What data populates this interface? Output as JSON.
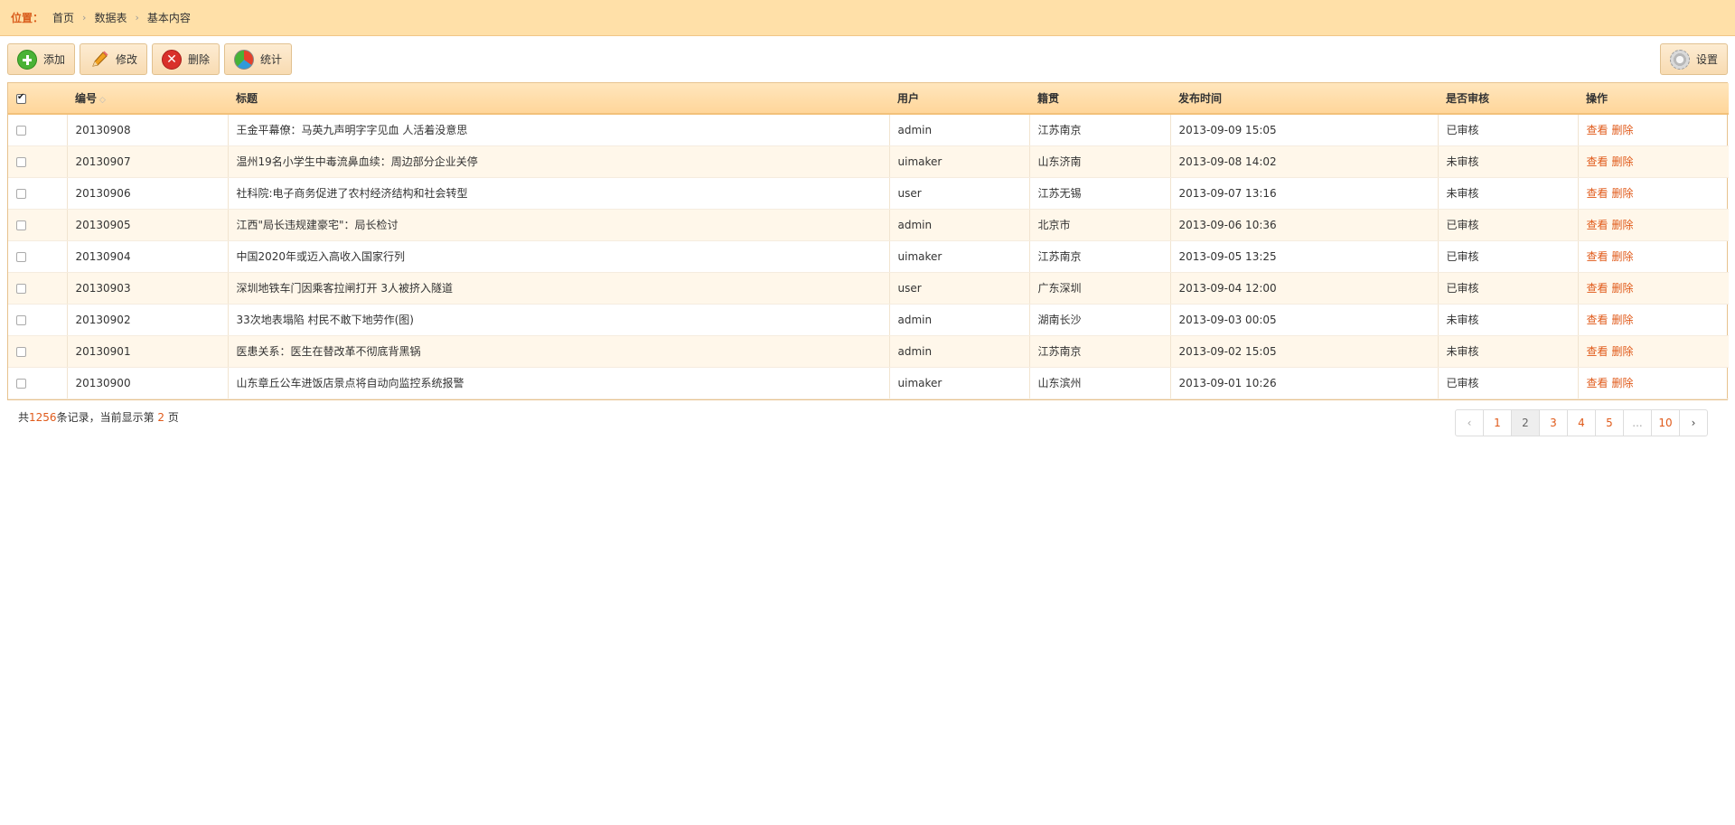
{
  "breadcrumb": {
    "label": "位置：",
    "items": [
      "首页",
      "数据表",
      "基本内容"
    ]
  },
  "toolbar": {
    "add_label": "添加",
    "edit_label": "修改",
    "delete_label": "删除",
    "stats_label": "统计",
    "settings_label": "设置"
  },
  "table": {
    "headers": [
      "编号",
      "标题",
      "用户",
      "籍贯",
      "发布时间",
      "是否审核",
      "操作"
    ],
    "actions": [
      "查看",
      "删除"
    ],
    "rows": [
      {
        "id": "20130908",
        "title": "王金平幕僚：马英九声明字字见血 人活着没意思",
        "user": "admin",
        "origin": "江苏南京",
        "time": "2013-09-09 15:05",
        "status": "已审核"
      },
      {
        "id": "20130907",
        "title": "温州19名小学生中毒流鼻血续：周边部分企业关停",
        "user": "uimaker",
        "origin": "山东济南",
        "time": "2013-09-08 14:02",
        "status": "未审核"
      },
      {
        "id": "20130906",
        "title": "社科院:电子商务促进了农村经济结构和社会转型",
        "user": "user",
        "origin": "江苏无锡",
        "time": "2013-09-07 13:16",
        "status": "未审核"
      },
      {
        "id": "20130905",
        "title": "江西\"局长违规建豪宅\"：局长检讨",
        "user": "admin",
        "origin": "北京市",
        "time": "2013-09-06 10:36",
        "status": "已审核"
      },
      {
        "id": "20130904",
        "title": "中国2020年或迈入高收入国家行列",
        "user": "uimaker",
        "origin": "江苏南京",
        "time": "2013-09-05 13:25",
        "status": "已审核"
      },
      {
        "id": "20130903",
        "title": "深圳地铁车门因乘客拉闸打开 3人被挤入隧道",
        "user": "user",
        "origin": "广东深圳",
        "time": "2013-09-04 12:00",
        "status": "已审核"
      },
      {
        "id": "20130902",
        "title": "33次地表塌陷 村民不敢下地劳作(图)",
        "user": "admin",
        "origin": "湖南长沙",
        "time": "2013-09-03 00:05",
        "status": "未审核"
      },
      {
        "id": "20130901",
        "title": "医患关系：医生在替改革不彻底背黑锅",
        "user": "admin",
        "origin": "江苏南京",
        "time": "2013-09-02 15:05",
        "status": "未审核"
      },
      {
        "id": "20130900",
        "title": "山东章丘公车进饭店景点将自动向监控系统报警",
        "user": "uimaker",
        "origin": "山东滨州",
        "time": "2013-09-01 10:26",
        "status": "已审核"
      }
    ]
  },
  "footer": {
    "prefix": "共",
    "total": "1256",
    "middle": "条记录，当前显示第",
    "page": "2",
    "suffix": "页"
  },
  "pager": {
    "prev": "‹",
    "pages": [
      "1",
      "2",
      "3",
      "4",
      "5",
      "...",
      "10"
    ],
    "next": "›",
    "active": "2"
  }
}
